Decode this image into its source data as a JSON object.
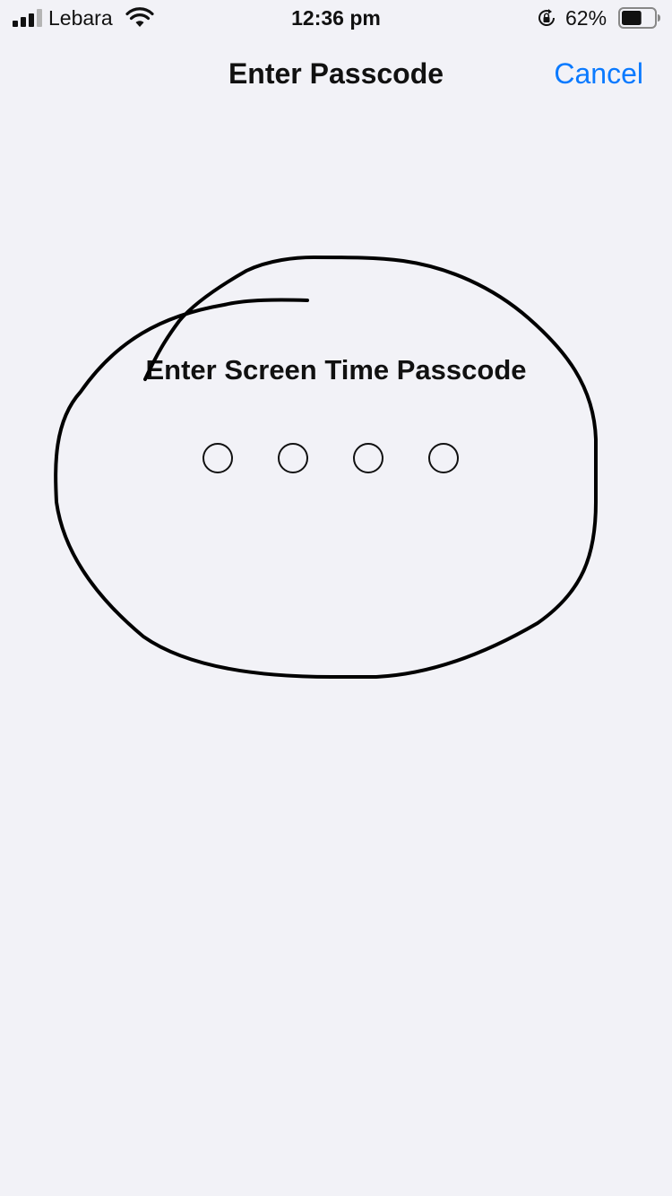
{
  "status_bar": {
    "carrier": "Lebara",
    "time": "12:36 pm",
    "battery_percent": "62%",
    "battery_level": 0.62,
    "icons": [
      "signal-icon",
      "wifi-icon",
      "rotation-lock-icon",
      "battery-icon"
    ]
  },
  "nav": {
    "title": "Enter Passcode",
    "cancel_label": "Cancel",
    "accent_color": "#0a7aff"
  },
  "passcode": {
    "prompt": "Enter Screen Time Passcode",
    "digits_total": 4,
    "digits_entered": 0
  },
  "colors": {
    "background": "#f2f2f7",
    "annotation_stroke": "#000000"
  }
}
